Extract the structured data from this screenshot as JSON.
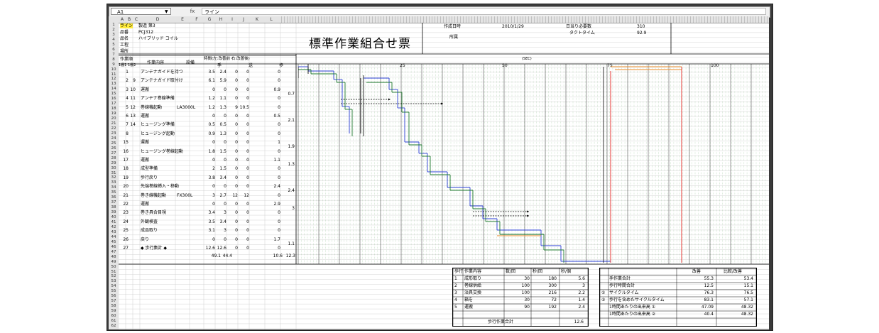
{
  "namebox": {
    "cell": "A1"
  },
  "formula": {
    "fx": "fx",
    "value": "ライン"
  },
  "columns": [
    "A",
    "B",
    "C",
    "D",
    "E",
    "F",
    "G",
    "H",
    "I",
    "J",
    "K",
    "L"
  ],
  "header": {
    "line_label": "ライン",
    "line_value": "製造 第3",
    "hinban_label": "品番",
    "hinban_value": "PCJ312",
    "hinmei_label": "品名",
    "hinmei_value": "ハイブリッド コイル",
    "kotei_label": "工程",
    "basho_label": "場所",
    "title": "標準作業組合せ票",
    "date_label": "作成日時",
    "date_value": "2010/1/29",
    "daily_label": "日当り必要数",
    "daily_value": "310",
    "dept_label": "所属",
    "takt_label": "タクトタイム",
    "takt_value": "92.9"
  },
  "table_head": {
    "col_no": "作業順",
    "col_no_sub": "1棚1 1棚2",
    "col_content": "作業内容",
    "col_equipment": "設備",
    "col_time": "時間(左:改善前 右:改善後)",
    "col_hand": "手",
    "col_send": "送",
    "col_walk": "歩",
    "sec_label": "(SEC)",
    "scale": [
      "25",
      "50",
      "75",
      "100"
    ]
  },
  "rows": [
    {
      "n1": "1",
      "n2": "",
      "desc": "アンテナガイドを持つ",
      "eq": "",
      "h1": "3.5",
      "h2": "2.4",
      "s1": "0",
      "s2": "0",
      "w1": "0",
      "w2": ""
    },
    {
      "n1": "2",
      "n2": "9",
      "desc": "アンテナガイド取付け",
      "eq": "",
      "h1": "6.1",
      "h2": "5.9",
      "s1": "0",
      "s2": "0",
      "w1": "0",
      "w2": ""
    },
    {
      "n1": "3",
      "n2": "10",
      "desc": "運搬",
      "eq": "",
      "h1": "0",
      "h2": "0",
      "s1": "0",
      "s2": "0",
      "w1": "0.9",
      "w2": "0.7"
    },
    {
      "n1": "4",
      "n2": "11",
      "desc": "アンテナ巻線準備",
      "eq": "",
      "h1": "1.2",
      "h2": "1.1",
      "s1": "0",
      "s2": "0",
      "w1": "0",
      "w2": ""
    },
    {
      "n1": "5",
      "n2": "12",
      "desc": "巻線機起動",
      "eq": "LA3000L",
      "h1": "1.2",
      "h2": "1.3",
      "s1": "9",
      "s2": "10.5",
      "w1": "0",
      "w2": ""
    },
    {
      "n1": "6",
      "n2": "13",
      "desc": "運搬",
      "eq": "",
      "h1": "0",
      "h2": "0",
      "s1": "0",
      "s2": "0",
      "w1": "0.5",
      "w2": "2.1"
    },
    {
      "n1": "7",
      "n2": "14",
      "desc": "ヒュージング準備",
      "eq": "",
      "h1": "0.5",
      "h2": "0.5",
      "s1": "0",
      "s2": "0",
      "w1": "0",
      "w2": ""
    },
    {
      "n1": "8",
      "n2": "",
      "desc": "ヒュージング起動",
      "eq": "",
      "h1": "0.9",
      "h2": "1.3",
      "s1": "0",
      "s2": "0",
      "w1": "0",
      "w2": ""
    },
    {
      "n1": "15",
      "n2": "",
      "desc": "運搬",
      "eq": "",
      "h1": "0",
      "h2": "0",
      "s1": "0",
      "s2": "0",
      "w1": "1",
      "w2": "1.9"
    },
    {
      "n1": "16",
      "n2": "",
      "desc": "ヒュージング巻線起動",
      "eq": "",
      "h1": "1.8",
      "h2": "1.5",
      "s1": "0",
      "s2": "0",
      "w1": "0",
      "w2": ""
    },
    {
      "n1": "17",
      "n2": "",
      "desc": "運搬",
      "eq": "",
      "h1": "0",
      "h2": "0",
      "s1": "0",
      "s2": "0",
      "w1": "1.1",
      "w2": "1.3"
    },
    {
      "n1": "18",
      "n2": "",
      "desc": "成型準備",
      "eq": "",
      "h1": "2",
      "h2": "1.5",
      "s1": "0",
      "s2": "0",
      "w1": "0",
      "w2": ""
    },
    {
      "n1": "19",
      "n2": "",
      "desc": "歩行戻り",
      "eq": "",
      "h1": "3.8",
      "h2": "3.4",
      "s1": "0",
      "s2": "0",
      "w1": "0",
      "w2": ""
    },
    {
      "n1": "20",
      "n2": "",
      "desc": "先端巻線挿入・移動",
      "eq": "",
      "h1": "0",
      "h2": "0",
      "s1": "0",
      "s2": "0",
      "w1": "2.4",
      "w2": "2.4"
    },
    {
      "n1": "21",
      "n2": "",
      "desc": "巻き線機起動",
      "eq": "FX300L",
      "h1": "3",
      "h2": "2.7",
      "s1": "12",
      "s2": "12",
      "w1": "0",
      "w2": ""
    },
    {
      "n1": "22",
      "n2": "",
      "desc": "運搬",
      "eq": "",
      "h1": "0",
      "h2": "0",
      "s1": "0",
      "s2": "0",
      "w1": "2.9",
      "w2": "3"
    },
    {
      "n1": "23",
      "n2": "",
      "desc": "巻き具合目視",
      "eq": "",
      "h1": "3.4",
      "h2": "3",
      "s1": "0",
      "s2": "0",
      "w1": "0",
      "w2": ""
    },
    {
      "n1": "24",
      "n2": "",
      "desc": "外観検査",
      "eq": "",
      "h1": "3.5",
      "h2": "3.4",
      "s1": "0",
      "s2": "0",
      "w1": "0",
      "w2": ""
    },
    {
      "n1": "25",
      "n2": "",
      "desc": "成品取り",
      "eq": "",
      "h1": "3.1",
      "h2": "3",
      "s1": "0",
      "s2": "0",
      "w1": "0",
      "w2": ""
    },
    {
      "n1": "26",
      "n2": "",
      "desc": "戻り",
      "eq": "",
      "h1": "0",
      "h2": "0",
      "s1": "0",
      "s2": "0",
      "w1": "1.7",
      "w2": "1.1"
    },
    {
      "n1": "27",
      "n2": "",
      "desc": "◆ 歩行集計 ◆",
      "eq": "",
      "h1": "12.6",
      "h2": "12.6",
      "s1": "0",
      "s2": "0",
      "w1": "0",
      "w2": ""
    }
  ],
  "totals": {
    "h1": "49.1",
    "h2": "44.4",
    "w1": "10.6",
    "w2": "12.3"
  },
  "row_numbers": [
    "1",
    "2",
    "3",
    "4",
    "5",
    "6",
    "7",
    "8",
    "9",
    "10",
    "11",
    "12",
    "13",
    "14",
    "15",
    "16",
    "17",
    "18",
    "19",
    "20",
    "21",
    "22",
    "23",
    "24",
    "25",
    "26",
    "27",
    "28",
    "29",
    "30",
    "31",
    "32",
    "33",
    "34",
    "35",
    "36",
    "37",
    "38",
    "39",
    "40",
    "41",
    "42",
    "43",
    "44",
    "45",
    "46",
    "47",
    "48",
    "49",
    "50",
    "51",
    "52",
    "53",
    "54",
    "55",
    "56",
    "57",
    "58",
    "59",
    "60",
    "61",
    "62"
  ],
  "summary_left": {
    "headers": [
      "歩行",
      "作業内容",
      "数/回",
      "秒/回",
      "秒/個"
    ],
    "rows": [
      [
        "1",
        "成形取り",
        "30",
        "180",
        "5.6"
      ],
      [
        "2",
        "巻線供給",
        "100",
        "300",
        "3"
      ],
      [
        "3",
        "治具交換",
        "100",
        "216",
        "2.2"
      ],
      [
        "4",
        "箱を",
        "30",
        "72",
        "1.4"
      ],
      [
        "5",
        "運搬",
        "90",
        "192",
        "2.4"
      ]
    ],
    "total_label": "歩行作業合計",
    "total_value": "12.6"
  },
  "summary_right": {
    "headers": [
      "",
      "改善",
      "比較/改善"
    ],
    "rows": [
      [
        "",
        "手作業合計",
        "55.3",
        "53.4"
      ],
      [
        "",
        "歩行時間合計",
        "12.5",
        "15.1"
      ],
      [
        "①",
        "サイクルタイム",
        "76.3",
        "76.5"
      ],
      [
        "②",
        "歩行を含めたサイクルタイム",
        "83.1",
        "57.1"
      ],
      [
        "",
        "1時間あたりの出来高 ①",
        "47.09",
        "48.32"
      ],
      [
        "",
        "1時間あたりの出来高 ②",
        "40.4",
        "48.32"
      ]
    ]
  }
}
